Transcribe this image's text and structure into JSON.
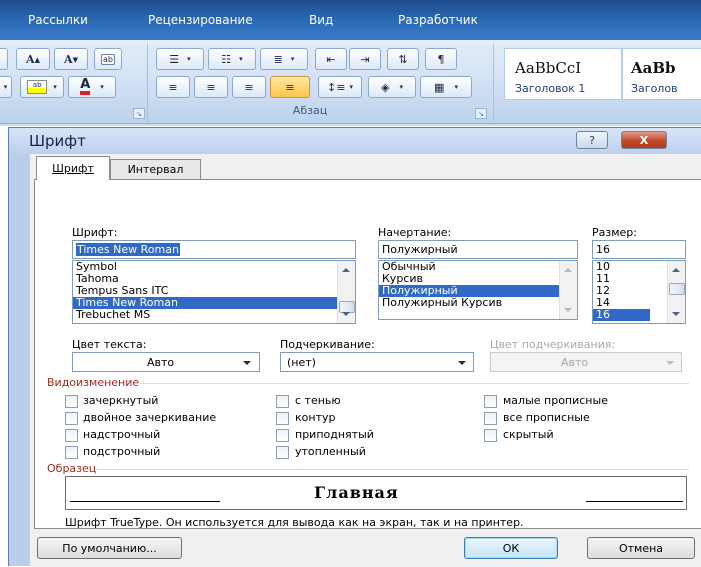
{
  "ribbon": {
    "tabs": [
      "Рассылки",
      "Рецензирование",
      "Вид",
      "Разработчик"
    ],
    "font_group": {
      "grow_label": "A",
      "shrink_label": "A",
      "clear_label": "ab"
    },
    "paragraph_group_label": "Абзац",
    "styles": [
      {
        "sample": "AaBbCcI",
        "name": "Заголовок 1"
      },
      {
        "sample": "AaBb",
        "name": "Заголов"
      }
    ],
    "colors": {
      "tab_bar": "#2c6bb6",
      "ribbon": "#cfdff3"
    }
  },
  "dialog": {
    "title": "Шрифт",
    "help_label": "?",
    "close_label": "X",
    "tabs": [
      {
        "label": "Шрифт",
        "active": true
      },
      {
        "label": "Интервал",
        "active": false
      }
    ],
    "font": {
      "label": "Шрифт:",
      "value": "Times New Roman",
      "list": [
        "Symbol",
        "Tahoma",
        "Tempus Sans ITC",
        "Times New Roman",
        "Trebuchet MS"
      ],
      "selected": "Times New Roman"
    },
    "style": {
      "label": "Начертание:",
      "value": "Полужирный",
      "list": [
        "Обычный",
        "Курсив",
        "Полужирный",
        "Полужирный Курсив"
      ],
      "selected": "Полужирный"
    },
    "size": {
      "label": "Размер:",
      "value": "16",
      "list": [
        "10",
        "11",
        "12",
        "14",
        "16"
      ],
      "selected": "16"
    },
    "color": {
      "label": "Цвет текста:",
      "value": "Авто"
    },
    "underline": {
      "label": "Подчеркивание:",
      "value": "(нет)"
    },
    "underline_color": {
      "label": "Цвет подчеркивания:",
      "value": "Авто",
      "enabled": false
    },
    "effects": {
      "title": "Видоизменение",
      "items": [
        {
          "label": "зачеркнутый",
          "checked": false
        },
        {
          "label": "двойное зачеркивание",
          "checked": false
        },
        {
          "label": "надстрочный",
          "checked": false
        },
        {
          "label": "подстрочный",
          "checked": false
        },
        {
          "label": "с тенью",
          "checked": false
        },
        {
          "label": "контур",
          "checked": false
        },
        {
          "label": "приподнятый",
          "checked": false
        },
        {
          "label": "утопленный",
          "checked": false
        },
        {
          "label": "малые прописные",
          "checked": false
        },
        {
          "label": "все прописные",
          "checked": false
        },
        {
          "label": "скрытый",
          "checked": false
        }
      ]
    },
    "preview": {
      "title": "Образец",
      "text": "Главная",
      "note": "Шрифт TrueType. Он используется для вывода как на экран, так и на принтер."
    },
    "buttons": {
      "default": "По умолчанию...",
      "ok": "ОК",
      "cancel": "Отмена"
    },
    "colors": {
      "selection": "#3169c6",
      "section_title": "#9b2c1c"
    }
  }
}
